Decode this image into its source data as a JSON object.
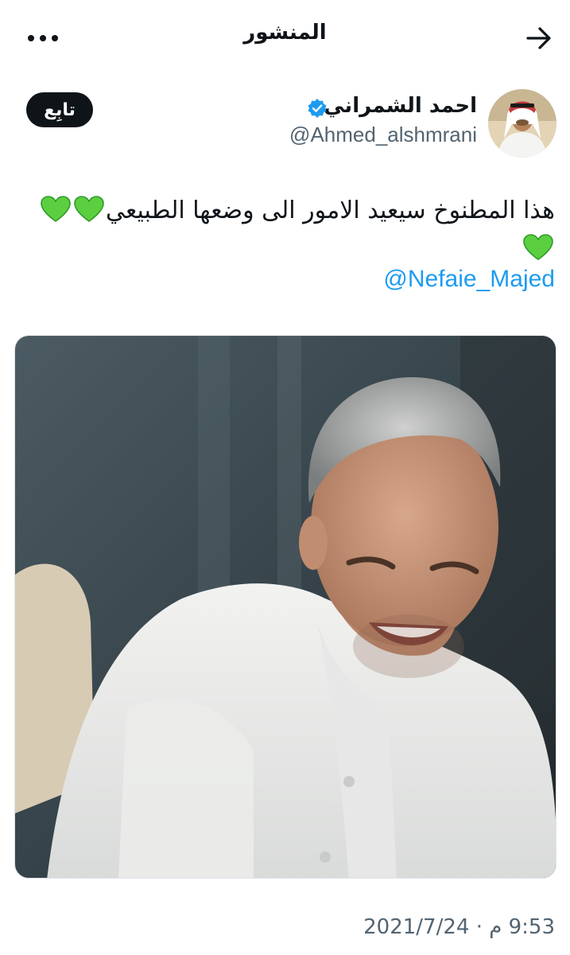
{
  "header": {
    "title": "المنشور",
    "back_icon": "arrow-right-icon",
    "more_icon": "more-horizontal-icon"
  },
  "author": {
    "name": "احمد الشمراني",
    "handle": "@Ahmed_alshmrani",
    "verified": true,
    "follow_label": "تابِع"
  },
  "tweet": {
    "text": "هذا المطنوخ سيعيد الامور الى وضعها الطبيعي",
    "emoji": "green-heart",
    "emoji_count": 3,
    "mention": "@Nefaie_Majed"
  },
  "media": {
    "alt": "photo"
  },
  "meta": {
    "time": "9:53 م",
    "date": "2021/7/24"
  },
  "colors": {
    "text": "#0f1419",
    "secondary": "#536471",
    "link": "#1d9bf0",
    "verified": "#1d9bf0",
    "heart": "#5bcf3f"
  }
}
